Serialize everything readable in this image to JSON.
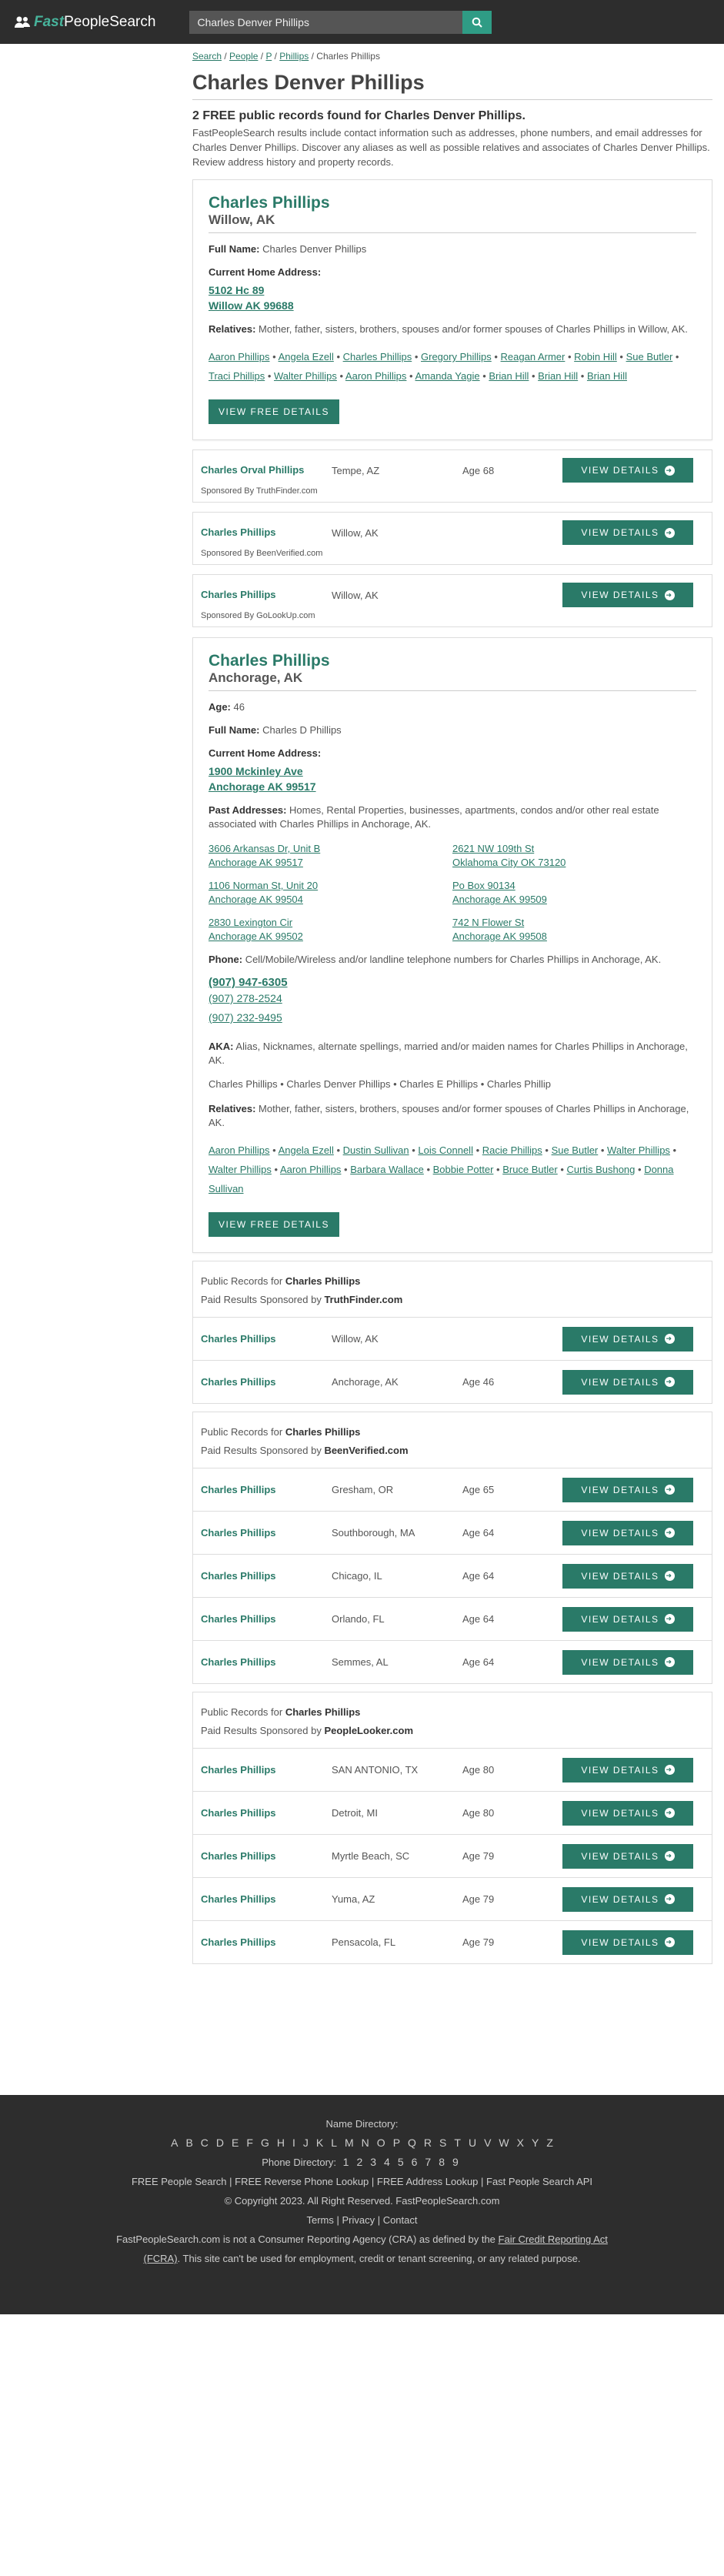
{
  "header": {
    "logo_fast": "Fast",
    "logo_rest": "PeopleSearch",
    "search_value": "Charles Denver Phillips"
  },
  "breadcrumb": {
    "search": "Search",
    "people": "People",
    "letter": "P",
    "surname": "Phillips",
    "current": "Charles Phillips"
  },
  "page": {
    "title": "Charles Denver Phillips",
    "subtitle": "2 FREE public records found for Charles Denver Phillips.",
    "intro": "FastPeopleSearch results include contact information such as addresses, phone numbers, and email addresses for Charles Denver Phillips. Discover any aliases as well as possible relatives and associates of Charles Denver Phillips. Review address history and property records."
  },
  "labels": {
    "full_name": "Full Name:",
    "current_address": "Current Home Address:",
    "relatives": "Relatives:",
    "relatives_desc_willow": "Mother, father, sisters, brothers, spouses and/or former spouses of Charles Phillips in Willow, AK.",
    "age": "Age:",
    "past_addresses": "Past Addresses:",
    "past_desc": "Homes, Rental Properties, businesses, apartments, condos and/or other real estate associated with Charles Phillips in Anchorage, AK.",
    "phone": "Phone:",
    "phone_desc": "Cell/Mobile/Wireless and/or landline telephone numbers for Charles Phillips in Anchorage, AK.",
    "aka": "AKA:",
    "aka_desc": "Alias, Nicknames, alternate spellings, married and/or maiden names for Charles Phillips in Anchorage, AK.",
    "relatives_desc_anch": "Mother, father, sisters, brothers, spouses and/or former spouses of Charles Phillips in Anchorage, AK.",
    "view_free": "VIEW FREE DETAILS",
    "view": "VIEW DETAILS",
    "public_records_for": "Public Records for",
    "paid_results": "Paid Results Sponsored by"
  },
  "record1": {
    "name": "Charles Phillips",
    "location": "Willow, AK",
    "full_name": "Charles Denver Phillips",
    "address1": "5102 Hc 89",
    "address2": "Willow AK 99688",
    "relatives": [
      "Aaron Phillips",
      "Angela Ezell",
      "Charles Phillips",
      "Gregory Phillips",
      "Reagan Armer",
      "Robin Hill",
      "Sue Butler",
      "Traci Phillips",
      "Walter Phillips",
      "Aaron Phillips",
      "Amanda Yagie",
      "Brian Hill",
      "Brian Hill",
      "Brian Hill"
    ]
  },
  "ads1": [
    {
      "name": "Charles Orval Phillips",
      "location": "Tempe, AZ",
      "age": "Age 68",
      "sponsor": "Sponsored By TruthFinder.com"
    },
    {
      "name": "Charles Phillips",
      "location": "Willow, AK",
      "age": "",
      "sponsor": "Sponsored By BeenVerified.com"
    },
    {
      "name": "Charles Phillips",
      "location": "Willow, AK",
      "age": "",
      "sponsor": "Sponsored By GoLookUp.com"
    }
  ],
  "record2": {
    "name": "Charles Phillips",
    "location": "Anchorage, AK",
    "age": "46",
    "full_name": "Charles D Phillips",
    "address1": "1900 Mckinley Ave",
    "address2": "Anchorage AK 99517",
    "past": [
      [
        "3606 Arkansas Dr, Unit B",
        "Anchorage AK 99517"
      ],
      [
        "2621 NW 109th St",
        "Oklahoma City OK 73120"
      ],
      [
        "1106 Norman St, Unit 20",
        "Anchorage AK 99504"
      ],
      [
        "Po Box 90134",
        "Anchorage AK 99509"
      ],
      [
        "2830 Lexington Cir",
        "Anchorage AK 99502"
      ],
      [
        "742 N Flower St",
        "Anchorage AK 99508"
      ]
    ],
    "phones": [
      "(907) 947-6305",
      "(907) 278-2524",
      "(907) 232-9495"
    ],
    "aka": "Charles Phillips • Charles Denver Phillips • Charles E Phillips • Charles Phillip",
    "relatives": [
      "Aaron Phillips",
      "Angela Ezell",
      "Dustin Sullivan",
      "Lois Connell",
      "Racie Phillips",
      "Sue Butler",
      "Walter Phillips",
      "Walter Phillips",
      "Aaron Phillips",
      "Barbara Wallace",
      "Bobbie Potter",
      "Bruce Butler",
      "Curtis Bushong",
      "Donna Sullivan"
    ]
  },
  "groups": [
    {
      "name": "Charles Phillips",
      "sponsor": "TruthFinder.com",
      "rows": [
        {
          "name": "Charles Phillips",
          "location": "Willow, AK",
          "age": ""
        },
        {
          "name": "Charles Phillips",
          "location": "Anchorage, AK",
          "age": "Age 46"
        }
      ]
    },
    {
      "name": "Charles Phillips",
      "sponsor": "BeenVerified.com",
      "rows": [
        {
          "name": "Charles Phillips",
          "location": "Gresham, OR",
          "age": "Age 65"
        },
        {
          "name": "Charles Phillips",
          "location": "Southborough, MA",
          "age": "Age 64"
        },
        {
          "name": "Charles Phillips",
          "location": "Chicago, IL",
          "age": "Age 64"
        },
        {
          "name": "Charles Phillips",
          "location": "Orlando, FL",
          "age": "Age 64"
        },
        {
          "name": "Charles Phillips",
          "location": "Semmes, AL",
          "age": "Age 64"
        }
      ]
    },
    {
      "name": "Charles Phillips",
      "sponsor": "PeopleLooker.com",
      "rows": [
        {
          "name": "Charles Phillips",
          "location": "SAN ANTONIO, TX",
          "age": "Age 80"
        },
        {
          "name": "Charles Phillips",
          "location": "Detroit, MI",
          "age": "Age 80"
        },
        {
          "name": "Charles Phillips",
          "location": "Myrtle Beach, SC",
          "age": "Age 79"
        },
        {
          "name": "Charles Phillips",
          "location": "Yuma, AZ",
          "age": "Age 79"
        },
        {
          "name": "Charles Phillips",
          "location": "Pensacola, FL",
          "age": "Age 79"
        }
      ]
    }
  ],
  "footer": {
    "name_dir": "Name Directory:",
    "letters": [
      "A",
      "B",
      "C",
      "D",
      "E",
      "F",
      "G",
      "H",
      "I",
      "J",
      "K",
      "L",
      "M",
      "N",
      "O",
      "P",
      "Q",
      "R",
      "S",
      "T",
      "U",
      "V",
      "W",
      "X",
      "Y",
      "Z"
    ],
    "phone_dir": "Phone Directory:",
    "digits": [
      "1",
      "2",
      "3",
      "4",
      "5",
      "6",
      "7",
      "8",
      "9"
    ],
    "links": "FREE People Search | FREE Reverse Phone Lookup | FREE Address Lookup | Fast People Search API",
    "copyright": "© Copyright 2023. All Right Reserved. FastPeopleSearch.com",
    "legal": "Terms | Privacy | Contact",
    "disclaimer_a": "FastPeopleSearch.com is not a Consumer Reporting Agency (CRA) as defined by the ",
    "fcra": "Fair Credit Reporting Act (FCRA)",
    "disclaimer_b": ". This site can't be used for employment, credit or tenant screening, or any related purpose."
  }
}
